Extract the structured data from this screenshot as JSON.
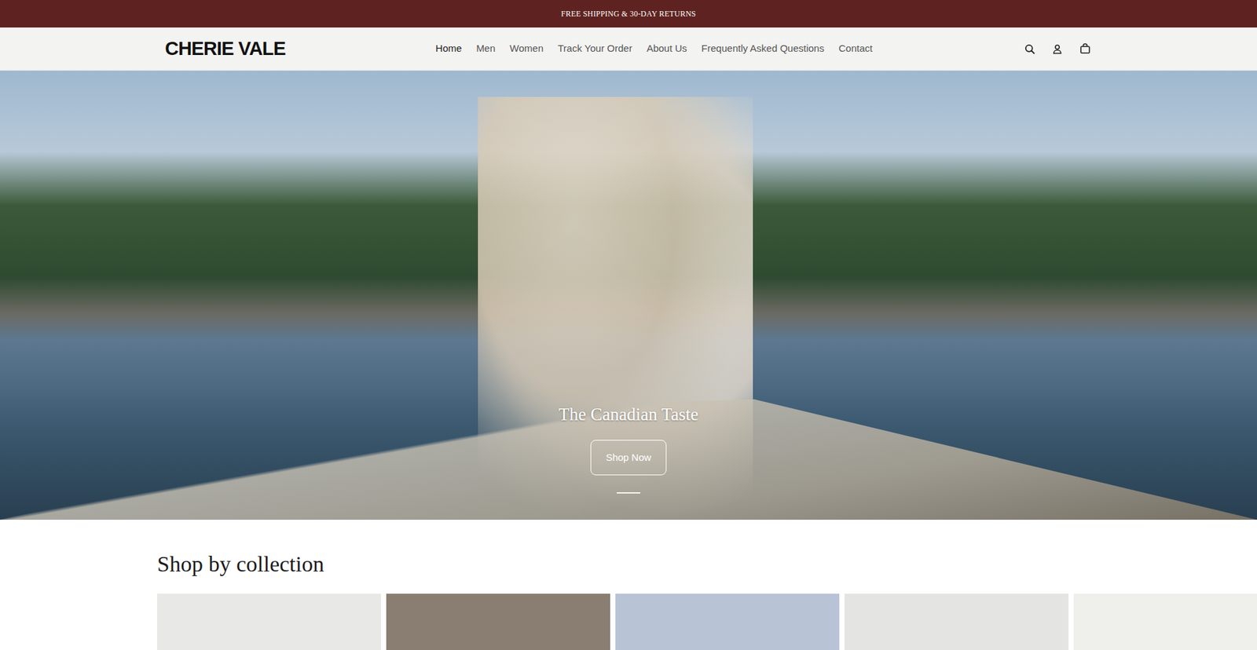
{
  "announcement": "FREE SHIPPING & 30-DAY RETURNS",
  "logo": "CHERIE VALE",
  "nav": [
    {
      "label": "Home",
      "selected": true
    },
    {
      "label": "Men",
      "selected": false
    },
    {
      "label": "Women",
      "selected": false
    },
    {
      "label": "Track Your Order",
      "selected": false
    },
    {
      "label": "About Us",
      "selected": false
    },
    {
      "label": "Frequently Asked Questions",
      "selected": false
    },
    {
      "label": "Contact",
      "selected": false
    }
  ],
  "hero": {
    "title": "The Canadian Taste",
    "button": "Shop Now",
    "slides": [
      {
        "selected": true
      }
    ]
  },
  "collections": {
    "title": "Shop by collection"
  }
}
